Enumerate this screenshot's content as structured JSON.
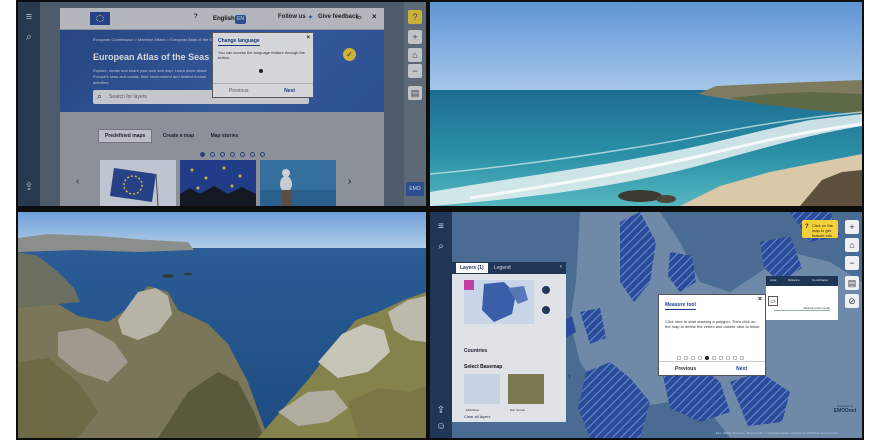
{
  "panels": {
    "top_left": {
      "header": {
        "language": "English",
        "language_badge": "EN",
        "follow_us": "Follow us",
        "give_feedback": "Give feedback"
      },
      "hero": {
        "breadcrumb": "European Commission > Maritime Affairs > European Atlas of the Seas",
        "title": "European Atlas of the Seas",
        "description": "Explore, create and share your own sea map. Learn more about Europe's seas and coasts, their environment and related human activities.",
        "search_placeholder": "Search for layers"
      },
      "tabs": [
        {
          "label": "Predefined maps"
        },
        {
          "label": "Create a map"
        },
        {
          "label": "Map stories"
        }
      ],
      "modal": {
        "title": "Change language",
        "body": "You can access the language feature through the button.",
        "previous": "Previous",
        "next": "Next",
        "close": "×"
      }
    },
    "bottom_right": {
      "tip": "Click on the map to get feature info",
      "layers_tab": "Layers (1)",
      "legend_tab": "Legend",
      "countries": "Countries",
      "select_basemap": "Select Basemap",
      "basemaps": [
        "EMODnet",
        "Esri Terrain"
      ],
      "clear_layers": "Clear all layers",
      "panel_tabs": [
        "Area",
        "Distance",
        "Coordinates"
      ],
      "measurement_label": "Measurement result",
      "modal": {
        "title": "Measure tool",
        "body": "Click here to start drawing a polygon. Then click on the map to define the vertex and double click to finish.",
        "previous": "Previous",
        "next": "Next",
        "close": "×"
      },
      "copyright": "Esri, HERE, DeLorme, MapmyIndia, © OpenStreetMap contributors, EMODnet and Eurostat",
      "powered_by": "Powered by",
      "logo": "EMODnet"
    }
  },
  "colors": {
    "eu_blue": "#2f5aa5",
    "accent_yellow": "#f4d13a",
    "rail_navy": "#203656",
    "layer_badge": "#c13fa5"
  },
  "icons": [
    "menu-icon",
    "search-icon",
    "help-icon",
    "twitter-icon",
    "feedback-icon",
    "close-icon",
    "plus-icon",
    "minus-icon",
    "print-icon",
    "share-icon",
    "home-icon",
    "pin-icon"
  ]
}
